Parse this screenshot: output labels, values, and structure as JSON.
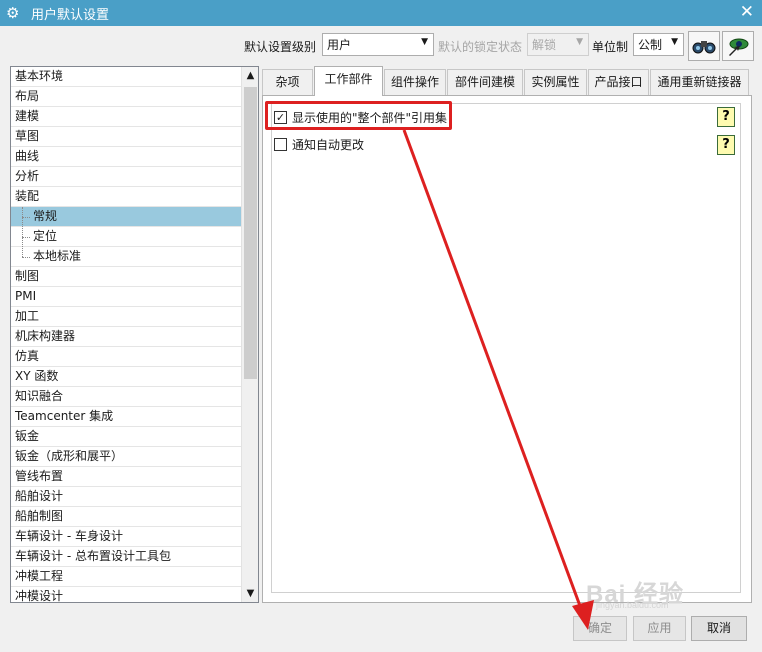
{
  "window": {
    "title": "用户默认设置",
    "close_label": "✕"
  },
  "toolbar": {
    "level_label": "默认设置级别",
    "level_value": "用户",
    "lock_label": "默认的锁定状态",
    "lock_value": "解锁",
    "units_label": "单位制",
    "units_value": "公制",
    "search_button_icon": "binoculars-icon",
    "find_button_icon": "eye-pointer-icon"
  },
  "tree": {
    "items": [
      {
        "label": "基本环境",
        "child": false,
        "selected": false
      },
      {
        "label": "布局",
        "child": false,
        "selected": false
      },
      {
        "label": "建模",
        "child": false,
        "selected": false
      },
      {
        "label": "草图",
        "child": false,
        "selected": false
      },
      {
        "label": "曲线",
        "child": false,
        "selected": false
      },
      {
        "label": "分析",
        "child": false,
        "selected": false
      },
      {
        "label": "装配",
        "child": false,
        "selected": false
      },
      {
        "label": "常规",
        "child": true,
        "selected": true
      },
      {
        "label": "定位",
        "child": true,
        "selected": false
      },
      {
        "label": "本地标准",
        "child": true,
        "selected": false
      },
      {
        "label": "制图",
        "child": false,
        "selected": false
      },
      {
        "label": "PMI",
        "child": false,
        "selected": false
      },
      {
        "label": "加工",
        "child": false,
        "selected": false
      },
      {
        "label": "机床构建器",
        "child": false,
        "selected": false
      },
      {
        "label": "仿真",
        "child": false,
        "selected": false
      },
      {
        "label": "XY 函数",
        "child": false,
        "selected": false
      },
      {
        "label": "知识融合",
        "child": false,
        "selected": false
      },
      {
        "label": "Teamcenter 集成",
        "child": false,
        "selected": false
      },
      {
        "label": "钣金",
        "child": false,
        "selected": false
      },
      {
        "label": "钣金（成形和展平）",
        "child": false,
        "selected": false
      },
      {
        "label": "管线布置",
        "child": false,
        "selected": false
      },
      {
        "label": "船舶设计",
        "child": false,
        "selected": false
      },
      {
        "label": "船舶制图",
        "child": false,
        "selected": false
      },
      {
        "label": "车辆设计 - 车身设计",
        "child": false,
        "selected": false
      },
      {
        "label": "车辆设计 - 总布置设计工具包",
        "child": false,
        "selected": false
      },
      {
        "label": "冲模工程",
        "child": false,
        "selected": false
      },
      {
        "label": "冲模设计",
        "child": false,
        "selected": false
      }
    ]
  },
  "tabs": [
    {
      "label": "杂项",
      "active": false
    },
    {
      "label": "工作部件",
      "active": true
    },
    {
      "label": "组件操作",
      "active": false
    },
    {
      "label": "部件间建模",
      "active": false
    },
    {
      "label": "实例属性",
      "active": false
    },
    {
      "label": "产品接口",
      "active": false
    },
    {
      "label": "通用重新链接器",
      "active": false
    }
  ],
  "options": [
    {
      "label": "显示使用的\"整个部件\"引用集",
      "checked": true,
      "help": "?"
    },
    {
      "label": "通知自动更改",
      "checked": false,
      "help": "?"
    }
  ],
  "buttons": {
    "ok": "确定",
    "apply": "应用",
    "cancel": "取消"
  },
  "watermark": {
    "text": "Bai 经验",
    "sub": "jingyan.baidu.com"
  },
  "colors": {
    "titlebar": "#4a9fc7",
    "selection": "#99c9de",
    "annotation": "#dd2020"
  }
}
